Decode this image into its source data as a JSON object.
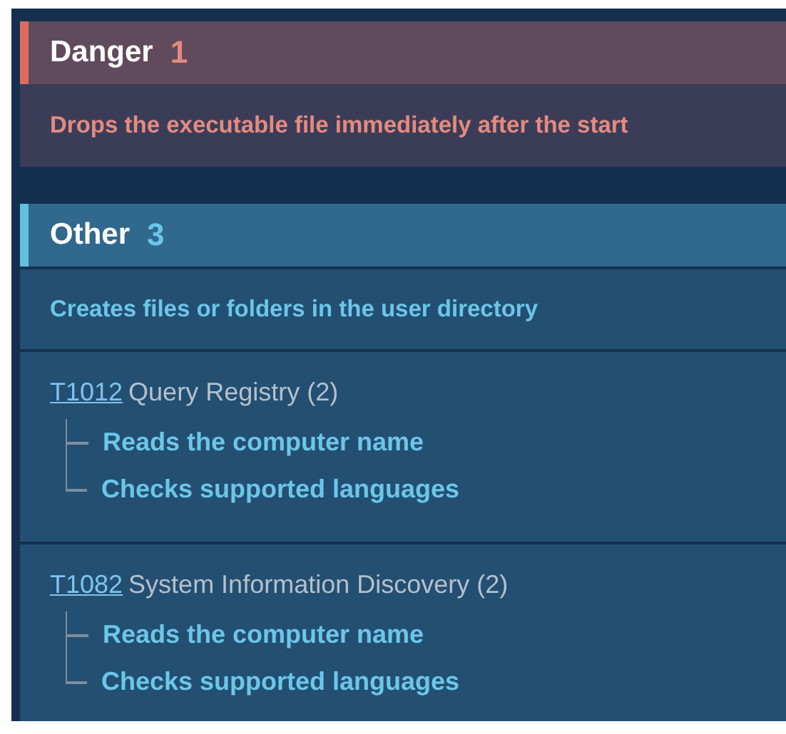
{
  "sections": [
    {
      "kind": "danger",
      "title": "Danger",
      "count": "1",
      "items": [
        {
          "kind": "description",
          "text": "Drops the executable file immediately after the start"
        }
      ]
    },
    {
      "kind": "other",
      "title": "Other",
      "count": "3",
      "items": [
        {
          "kind": "description",
          "text": "Creates files or folders in the user directory"
        },
        {
          "kind": "technique",
          "id": "T1012",
          "name": "Query Registry (2)",
          "children": [
            {
              "text": "Reads the computer name"
            },
            {
              "text": "Checks supported languages"
            }
          ]
        },
        {
          "kind": "technique",
          "id": "T1082",
          "name": "System Information Discovery (2)",
          "children": [
            {
              "text": "Reads the computer name"
            },
            {
              "text": "Checks supported languages"
            }
          ]
        }
      ]
    }
  ]
}
